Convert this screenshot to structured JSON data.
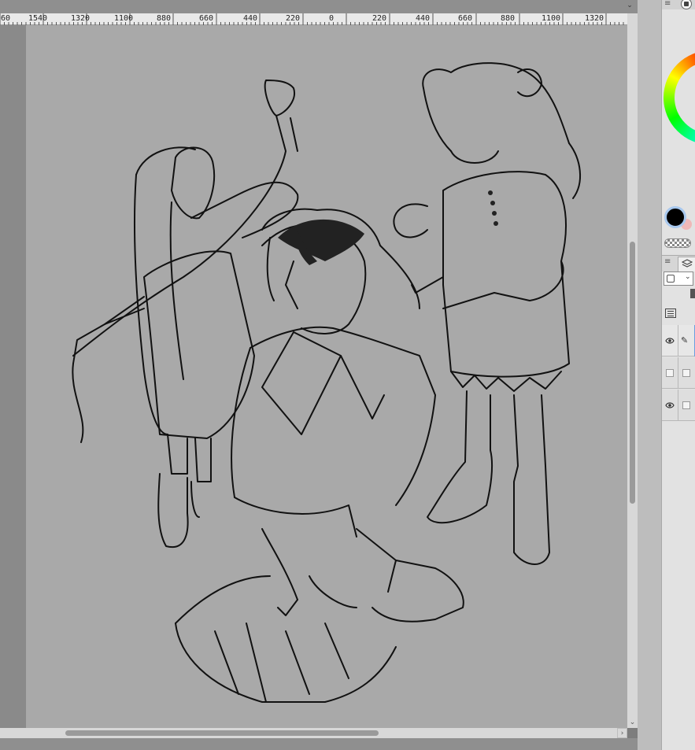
{
  "ruler": {
    "labels": [
      "60",
      "1540",
      "1320",
      "1100",
      "880",
      "660",
      "440",
      "220",
      "0",
      "220",
      "440",
      "660",
      "880",
      "1100",
      "1320"
    ]
  },
  "icons": {
    "top_chevron": "chevron-down-icon",
    "panel_menu": "hamburger-icon",
    "layer_menu": "hamburger-icon",
    "layer_tab": "layers-icon",
    "eye": "eye-icon",
    "pen": "pen-icon"
  },
  "glyphs": {
    "chevron": "⌄",
    "menu": "≡",
    "right_arrow": "›",
    "eye": "👁",
    "pen": "✎"
  },
  "colors": {
    "main": "#000000",
    "sub": "#f0b8b8",
    "selection": "#6a9ee0"
  },
  "layers": [
    {
      "visible": true,
      "editing": true,
      "selected": true
    },
    {
      "visible": false,
      "editing": false,
      "selected": false
    },
    {
      "visible": true,
      "editing": false,
      "selected": false
    }
  ]
}
